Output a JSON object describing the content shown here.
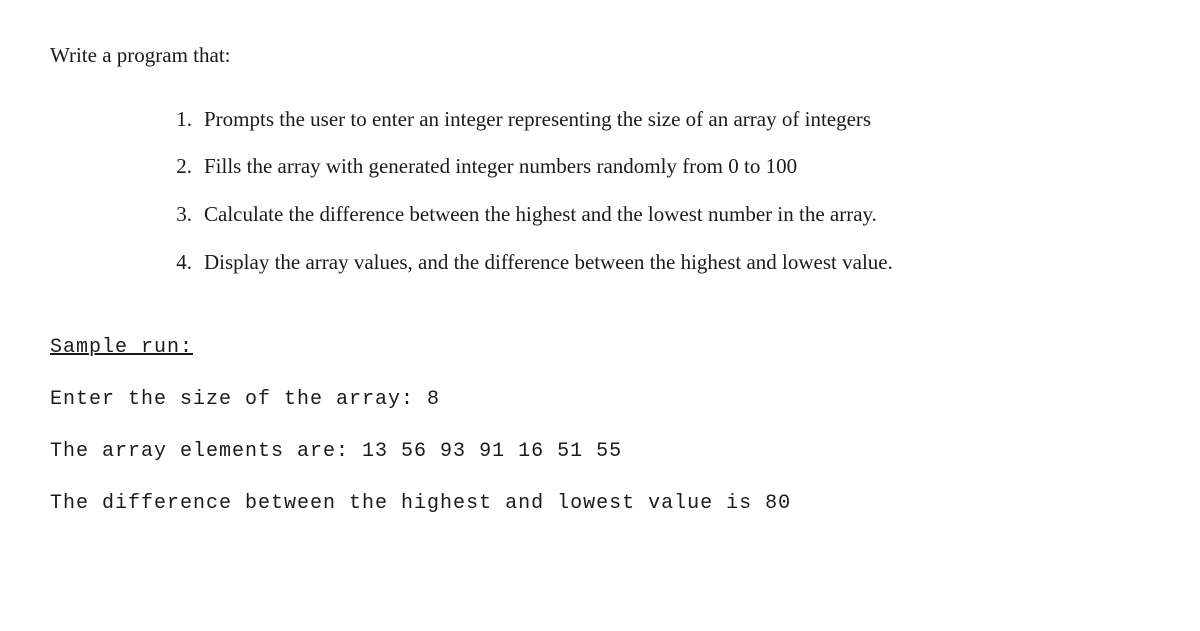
{
  "intro": "Write a program that:",
  "items": [
    {
      "marker": "1.",
      "text": "Prompts the user to enter an integer representing the size of an array of integers"
    },
    {
      "marker": "2.",
      "text": "Fills the array with generated integer numbers randomly from 0 to 100"
    },
    {
      "marker": "3.",
      "text": "Calculate the difference between the highest and the lowest number in the array."
    },
    {
      "marker": "4.",
      "text": "Display the array values, and the difference between the highest and lowest value."
    }
  ],
  "sample_heading": "Sample run:",
  "sample_lines": [
    "Enter the size of the array: 8",
    "The array elements are: 13 56 93 91 16 51 55",
    "The difference between the highest and lowest value is 80"
  ]
}
